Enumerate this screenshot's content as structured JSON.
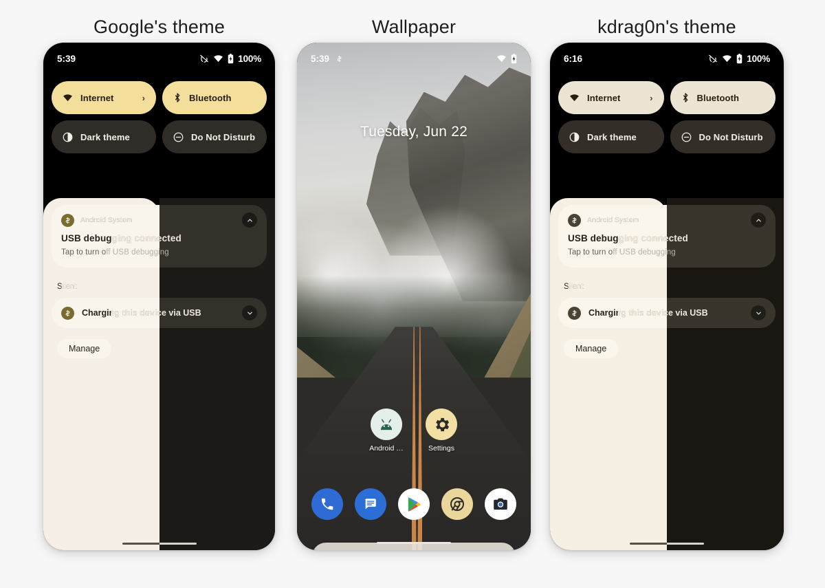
{
  "columns": [
    {
      "title": "Google's theme"
    },
    {
      "title": "Wallpaper"
    },
    {
      "title": "kdrag0n's theme"
    }
  ],
  "themes": {
    "google": {
      "accent": "#F4DE9B",
      "tile_off": "#302D28",
      "shade_light": "#F5EFE5",
      "shade_dark": "#1C1A16",
      "card_light": "#FAF5EC",
      "card_dark": "#34302A",
      "app_icon": "#7A6B2E",
      "status": {
        "time": "5:39",
        "battery_percent": "100%",
        "alarm_icon": "alarm-off-icon",
        "wifi_icon": "wifi-icon",
        "battery_icon": "battery-charging-icon"
      },
      "quick_settings": [
        {
          "label": "Internet",
          "icon": "wifi-icon",
          "state": "on",
          "chevron": "›"
        },
        {
          "label": "Bluetooth",
          "icon": "bluetooth-icon",
          "state": "on",
          "chevron": ""
        },
        {
          "label": "Dark theme",
          "icon": "dark-theme-icon",
          "state": "off",
          "chevron": ""
        },
        {
          "label": "Do Not Disturb",
          "icon": "do-not-disturb-icon",
          "state": "off",
          "chevron": ""
        }
      ],
      "notification": {
        "app_name": "Android System",
        "title": "USB debugging connected",
        "subtitle": "Tap to turn off USB debugging",
        "expand_icon": "chevron-up-icon"
      },
      "silent_label": "Silent",
      "silent_notification": {
        "title": "Charging this device via USB",
        "collapse_icon": "chevron-down-icon"
      },
      "manage_label": "Manage"
    },
    "kdragon": {
      "accent": "#EDE5D4",
      "tile_off": "#332E27",
      "shade_light": "#F6F0E4",
      "shade_dark": "#1A1712",
      "card_light": "#FBF6EB",
      "card_dark": "#3A352C",
      "app_icon": "#4A4235",
      "status": {
        "time": "6:16",
        "battery_percent": "100%",
        "alarm_icon": "alarm-off-icon",
        "wifi_icon": "wifi-icon",
        "battery_icon": "battery-charging-icon"
      },
      "quick_settings": [
        {
          "label": "Internet",
          "icon": "wifi-icon",
          "state": "on",
          "chevron": "›"
        },
        {
          "label": "Bluetooth",
          "icon": "bluetooth-icon",
          "state": "on",
          "chevron": ""
        },
        {
          "label": "Dark theme",
          "icon": "dark-theme-icon",
          "state": "off",
          "chevron": ""
        },
        {
          "label": "Do Not Disturb",
          "icon": "do-not-disturb-icon",
          "state": "off",
          "chevron": ""
        }
      ],
      "notification": {
        "app_name": "Android System",
        "title": "USB debugging connected",
        "subtitle": "Tap to turn off USB debugging",
        "expand_icon": "chevron-up-icon"
      },
      "silent_label": "Silent",
      "silent_notification": {
        "title": "Charging this device via USB",
        "collapse_icon": "chevron-down-icon"
      },
      "manage_label": "Manage"
    }
  },
  "wallpaper_phone": {
    "status": {
      "time": "5:39",
      "usb_icon": "usb-icon",
      "wifi_icon": "wifi-icon",
      "battery_icon": "battery-charging-icon"
    },
    "date": "Tuesday, Jun 22",
    "scene": "foggy mountain road with pine trees and double orange centre line",
    "home_apps": [
      {
        "label": "Android …",
        "icon": "android-icon",
        "bg": "#E4EFEA",
        "fg": "#2A6254"
      },
      {
        "label": "Settings",
        "icon": "settings-gear-icon",
        "bg": "#F2DFA4",
        "fg": "#2C2A26"
      }
    ],
    "dock_apps": [
      {
        "name": "phone",
        "icon": "phone-icon",
        "bg": "#2E6BD4",
        "fg": "#FFFFFF"
      },
      {
        "name": "messages",
        "icon": "messages-icon",
        "bg": "#2B6FD6",
        "fg": "#FFFFFF"
      },
      {
        "name": "play-store",
        "icon": "play-store-icon",
        "bg": "#FFFFFF",
        "fg": "#0F9D58"
      },
      {
        "name": "chrome",
        "icon": "chrome-icon",
        "bg": "#EBD79C",
        "fg": "#2B2A25"
      },
      {
        "name": "camera",
        "icon": "camera-icon",
        "bg": "#FFFFFF",
        "fg": "#1F2833"
      }
    ],
    "search": {
      "placeholder": "",
      "value": "",
      "logo_icon": "google-g-icon",
      "assistant_icon": "google-assistant-icon"
    }
  }
}
